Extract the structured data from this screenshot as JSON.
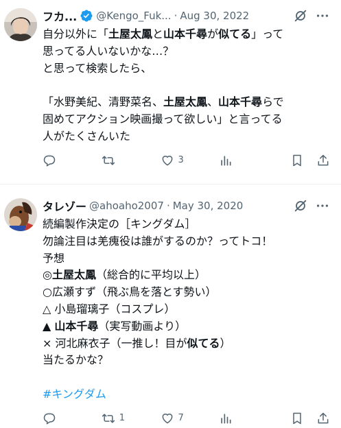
{
  "tweets": [
    {
      "display_name": "フカ...",
      "verified": true,
      "handle": "@Kengo_Fuk...",
      "sep": "·",
      "date": "Aug 30, 2022",
      "avatar_icon": "person-avatar-dark-hair",
      "lines": [
        [
          {
            "t": "自分以外に「"
          },
          {
            "t": "土屋太鳳",
            "b": true
          },
          {
            "t": "と"
          },
          {
            "t": "山本千尋",
            "b": true
          },
          {
            "t": "が"
          },
          {
            "t": "似てる",
            "b": true
          },
          {
            "t": "」って"
          }
        ],
        [
          {
            "t": "思ってる人いないかな…？"
          }
        ],
        [
          {
            "t": "と思って検索したら、"
          }
        ],
        [
          {
            "t": ""
          }
        ],
        [
          {
            "t": "「水野美紀、清野菜名、"
          },
          {
            "t": "土屋太鳳",
            "b": true
          },
          {
            "t": "、"
          },
          {
            "t": "山本千尋",
            "b": true
          },
          {
            "t": "らで"
          }
        ],
        [
          {
            "t": "固めてアクション映画撮って欲しい」と言ってる"
          }
        ],
        [
          {
            "t": "人がたくさんいた"
          }
        ]
      ],
      "actions": {
        "reply": "",
        "retweet": "",
        "like": "3",
        "views": ""
      }
    },
    {
      "display_name": "タレゾー",
      "verified": false,
      "handle": "@ahoaho2007",
      "sep": "·",
      "date": "May 30, 2020",
      "avatar_icon": "horse-plush-avatar",
      "lines": [
        [
          {
            "t": "続編製作決定の［キングダム］"
          }
        ],
        [
          {
            "t": "勿論注目は羌瘣役は誰がするのか？ってトコ！"
          }
        ],
        [
          {
            "t": "予想"
          }
        ],
        [
          {
            "t": "◎"
          },
          {
            "t": "土屋太鳳",
            "b": true
          },
          {
            "t": "（総合的に平均以上）"
          }
        ],
        [
          {
            "t": "○広瀬すず（飛ぶ鳥を落とす勢い）"
          }
        ],
        [
          {
            "t": "△ 小島瑠璃子（コスプレ）"
          }
        ],
        [
          {
            "t": "▲ "
          },
          {
            "t": "山本千尋",
            "b": true
          },
          {
            "t": "（実写動画より）"
          }
        ],
        [
          {
            "t": "× 河北麻衣子（一推し！目が"
          },
          {
            "t": "似てる",
            "b": true
          },
          {
            "t": "）"
          }
        ],
        [
          {
            "t": "当たるかな？"
          }
        ],
        [
          {
            "t": ""
          }
        ],
        [
          {
            "t": "#キングダム",
            "h": true
          }
        ]
      ],
      "actions": {
        "reply": "",
        "retweet": "1",
        "like": "7",
        "views": ""
      }
    }
  ],
  "colors": {
    "accent": "#1d9bf0",
    "muted": "#536471",
    "text": "#0f1419"
  }
}
